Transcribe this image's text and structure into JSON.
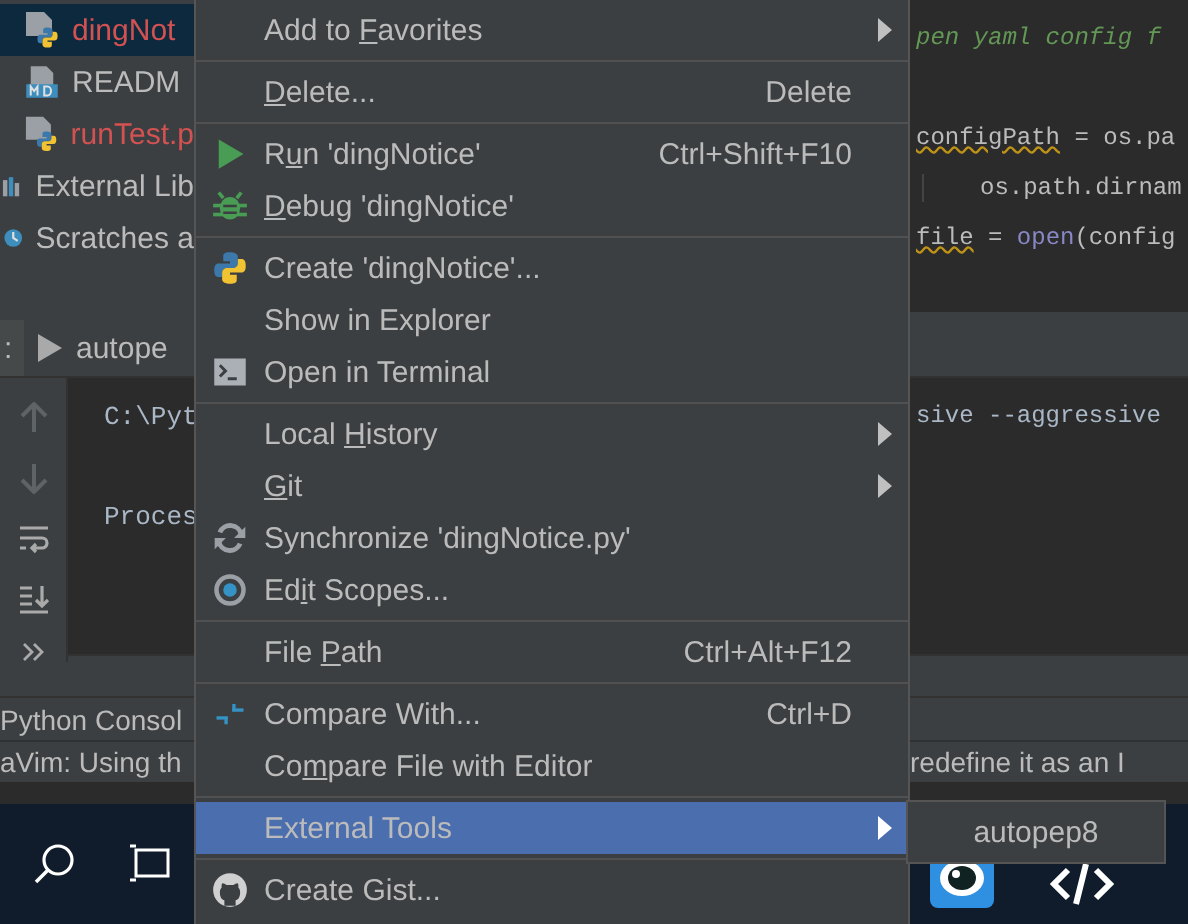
{
  "project_tree": {
    "items": [
      {
        "label": "dingNot",
        "kind": "python",
        "has_error": true,
        "selected": true
      },
      {
        "label": "READM",
        "kind": "markdown",
        "has_error": false,
        "selected": false
      },
      {
        "label": "runTest.p",
        "kind": "python",
        "has_error": true,
        "selected": false
      },
      {
        "label": "External Lib",
        "kind": "library",
        "has_error": false,
        "selected": false
      },
      {
        "label": "Scratches a",
        "kind": "scratch",
        "has_error": false,
        "selected": false
      }
    ]
  },
  "editor": {
    "lines": [
      {
        "kind": "comment",
        "text": "pen yaml config f"
      },
      {
        "kind": "blank"
      },
      {
        "kind": "warn",
        "text": "configPath",
        "rest": " = os.pa"
      },
      {
        "kind": "indent",
        "text": "os.path.dirnam"
      },
      {
        "kind": "call",
        "text": "file",
        "rest": " = ",
        "func": "open",
        "tail": "(config"
      }
    ]
  },
  "run_panel": {
    "tab_prefix": ":",
    "tab": "autope",
    "console_left": [
      "C:\\Pyt",
      "Proces"
    ],
    "console_right": [
      "sive --aggressive"
    ]
  },
  "bottom_tabs": {
    "python_console": "Python Consol"
  },
  "status_bar": {
    "left": "aVim: Using th",
    "right": "redefine it as an I"
  },
  "context_menu": {
    "groups": [
      [
        {
          "label": "Add to Favorites",
          "submenu": true,
          "selected": false
        }
      ],
      [
        {
          "label": "Delete...",
          "shortcut": "Delete",
          "selected": false
        }
      ],
      [
        {
          "label": "Run 'dingNotice'",
          "kind": "run",
          "shortcut": "Ctrl+Shift+F10",
          "selected": false
        },
        {
          "label": "Debug 'dingNotice'",
          "kind": "debug",
          "selected": false
        }
      ],
      [
        {
          "label": "Create 'dingNotice'...",
          "kind": "python",
          "selected": false
        },
        {
          "label": "Show in Explorer",
          "selected": false
        },
        {
          "label": "Open in Terminal",
          "kind": "terminal",
          "selected": false
        }
      ],
      [
        {
          "label": "Local History",
          "submenu": true,
          "selected": false
        },
        {
          "label": "Git",
          "submenu": true,
          "selected": false
        },
        {
          "label": "Synchronize 'dingNotice.py'",
          "kind": "sync",
          "selected": false
        },
        {
          "label": "Edit Scopes...",
          "kind": "scope",
          "selected": false
        }
      ],
      [
        {
          "label": "File Path",
          "shortcut": "Ctrl+Alt+F12",
          "selected": false
        }
      ],
      [
        {
          "label": "Compare With...",
          "kind": "compare",
          "shortcut": "Ctrl+D",
          "selected": false
        },
        {
          "label": "Compare File with Editor",
          "selected": false
        }
      ],
      [
        {
          "label": "External Tools",
          "submenu": true,
          "selected": true
        }
      ],
      [
        {
          "label": "Create Gist...",
          "kind": "github",
          "selected": false
        }
      ]
    ]
  },
  "submenu": {
    "items": [
      "autopep8"
    ]
  }
}
